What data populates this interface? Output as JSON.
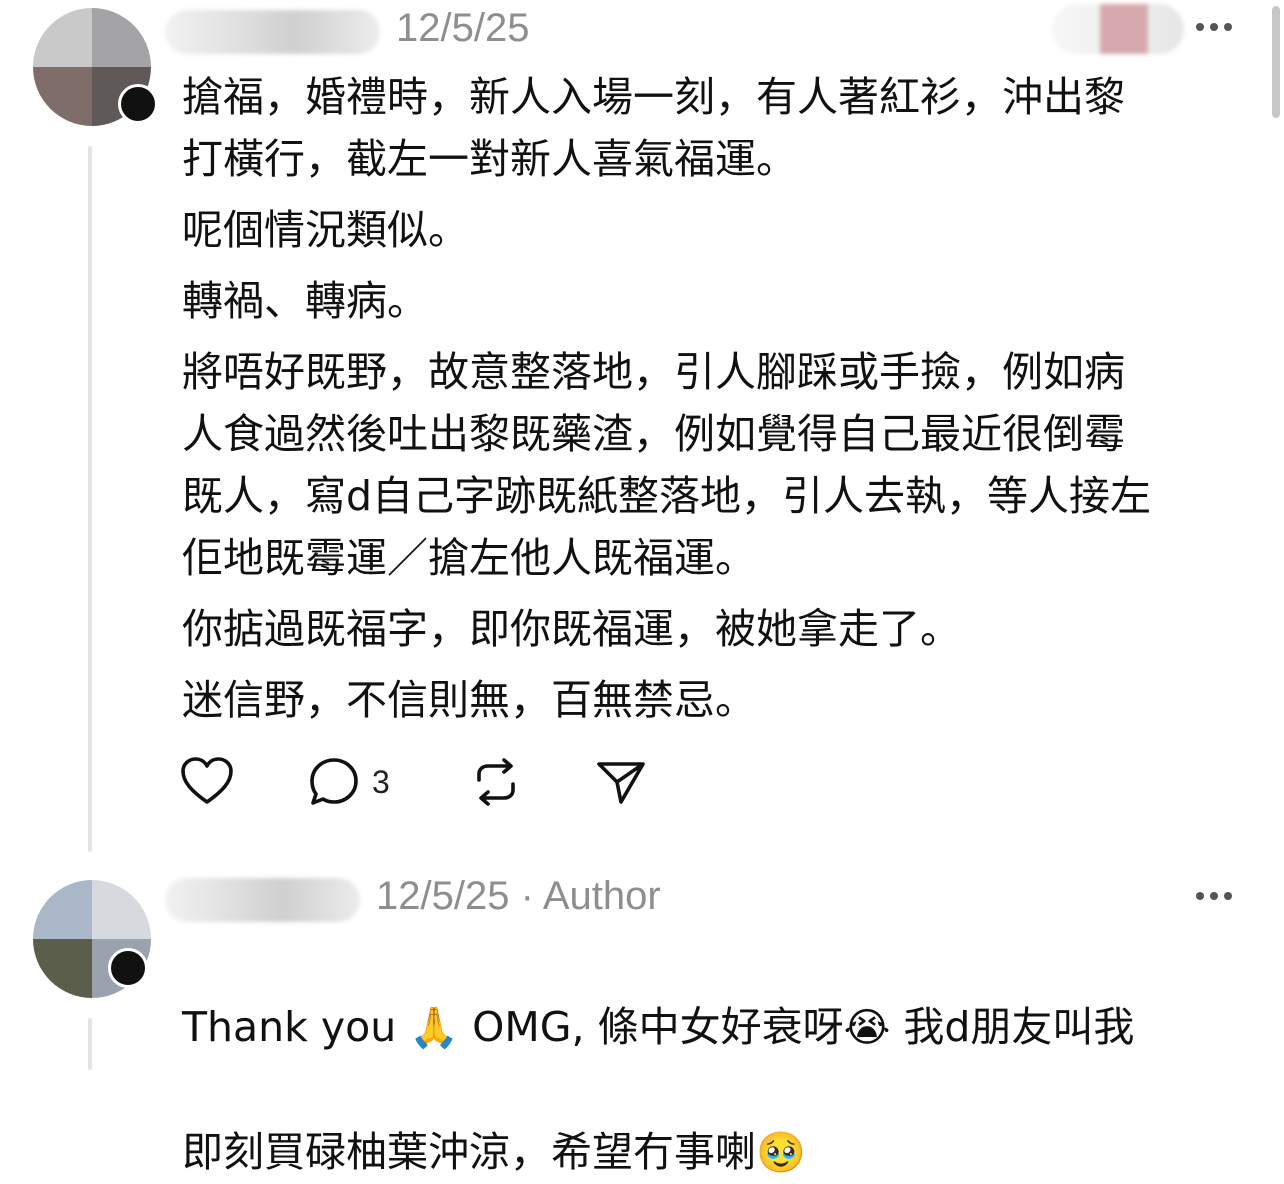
{
  "comment1": {
    "timestamp": "12/5/25",
    "paragraphs": [
      "搶福，婚禮時，新人入場一刻，有人著紅衫，沖出黎\n打橫行，截左一對新人喜氣福運。",
      "呢個情況類似。",
      "轉禍、轉病。",
      "將唔好既野，故意整落地，引人腳踩或手撿，例如病\n人食過然後吐出黎既藥渣，例如覺得自己最近很倒霉\n既人，寫d自己字跡既紙整落地，引人去執，等人接左\n佢地既霉運／搶左他人既福運。",
      "你掂過既福字，即你既福運，被她拿走了。",
      "迷信野，不信則無，百無禁忌。"
    ],
    "actions": {
      "like_icon": "heart-icon",
      "reply_icon": "comment-icon",
      "reply_count": "3",
      "repost_icon": "repost-icon",
      "share_icon": "send-icon"
    }
  },
  "comment2": {
    "timestamp": "12/5/25",
    "separator": "·",
    "author_tag": "Author",
    "line1_part1": "Thank you ",
    "line1_emoji1": "🙏",
    "line1_part2": " OMG, 條中女好衰呀",
    "line1_emoji2": "😭",
    "line1_part3": " 我d朋友叫我",
    "line2_part1": "即刻買碌柚葉沖涼，希望冇事喇",
    "line2_emoji": "🥹"
  },
  "colors": {
    "text": "#111111",
    "meta": "#8e8e8e",
    "thread_line": "#e3e3e3"
  }
}
